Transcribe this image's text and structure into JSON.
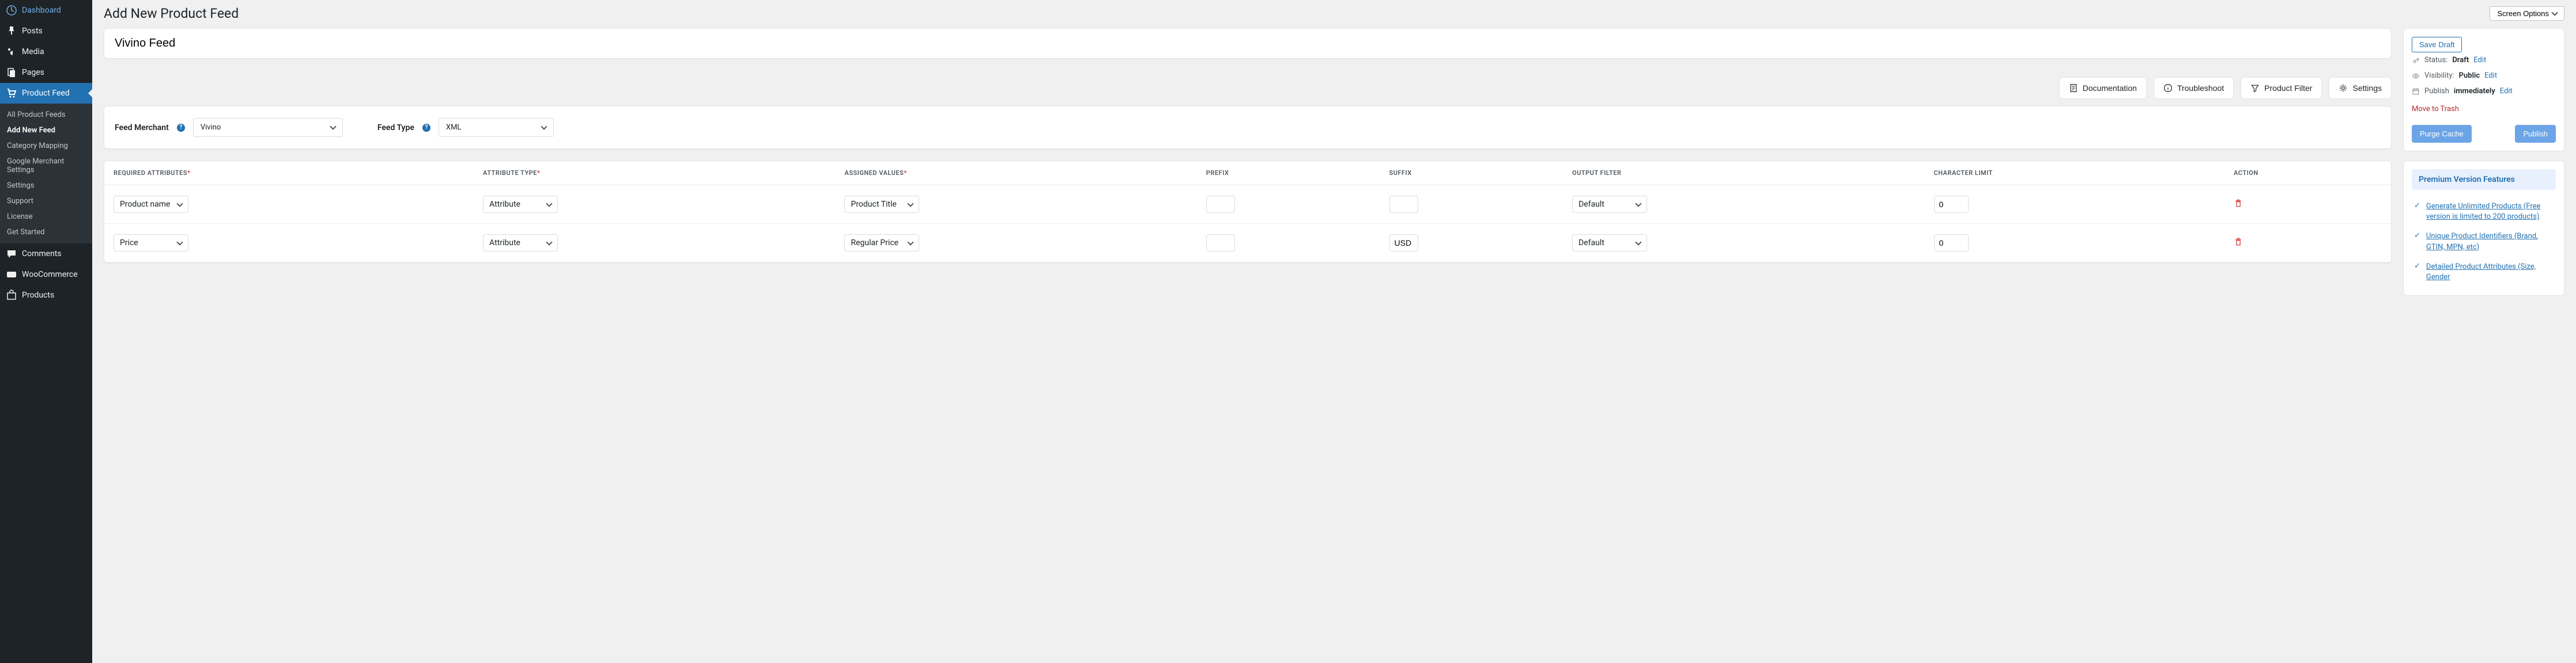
{
  "screen_options": "Screen Options",
  "nav": [
    {
      "label": "Dashboard"
    },
    {
      "label": "Posts"
    },
    {
      "label": "Media"
    },
    {
      "label": "Pages"
    },
    {
      "label": "Product Feed",
      "active": true
    },
    {
      "label": "Comments"
    },
    {
      "label": "WooCommerce"
    },
    {
      "label": "Products"
    }
  ],
  "submenu": [
    {
      "label": "All Product Feeds"
    },
    {
      "label": "Add New Feed",
      "current": true
    },
    {
      "label": "Category Mapping"
    },
    {
      "label": "Google Merchant Settings"
    },
    {
      "label": "Settings"
    },
    {
      "label": "Support"
    },
    {
      "label": "License"
    },
    {
      "label": "Get Started"
    }
  ],
  "page_title": "Add New Product Feed",
  "feed_title": "Vivino Feed",
  "toolbar": {
    "documentation": "Documentation",
    "troubleshoot": "Troubleshoot",
    "product_filter": "Product Filter",
    "settings": "Settings"
  },
  "config": {
    "merchant_label": "Feed Merchant",
    "merchant_value": "Vivino",
    "type_label": "Feed Type",
    "type_value": "XML"
  },
  "table": {
    "headers": {
      "required": "REQUIRED ATTRIBUTES",
      "attr_type": "ATTRIBUTE TYPE",
      "assigned": "ASSIGNED VALUES",
      "prefix": "PREFIX",
      "suffix": "SUFFIX",
      "filter": "OUTPUT FILTER",
      "limit": "CHARACTER LIMIT",
      "action": "ACTION"
    },
    "rows": [
      {
        "req": "Product name",
        "type": "Attribute",
        "assigned": "Product Title",
        "prefix": "",
        "suffix": "",
        "filter": "Default",
        "limit": "0"
      },
      {
        "req": "Price",
        "type": "Attribute",
        "assigned": "Regular Price",
        "prefix": "",
        "suffix": "USD",
        "filter": "Default",
        "limit": "0"
      }
    ]
  },
  "publish": {
    "save_draft": "Save Draft",
    "status_label": "Status:",
    "status_value": "Draft",
    "visibility_label": "Visibility:",
    "visibility_value": "Public",
    "publish_label": "Publish",
    "publish_value": "immediately",
    "edit": "Edit",
    "trash": "Move to Trash",
    "purge": "Purge Cache",
    "publish_btn": "Publish"
  },
  "premium": {
    "title": "Premium Version Features",
    "items": [
      "Generate Unlimited Products (Free version is limited to 200 products)",
      "Unique Product Identifiers (Brand, GTIN, MPN, etc)",
      "Detailed Product Attributes (Size, Gender"
    ]
  }
}
